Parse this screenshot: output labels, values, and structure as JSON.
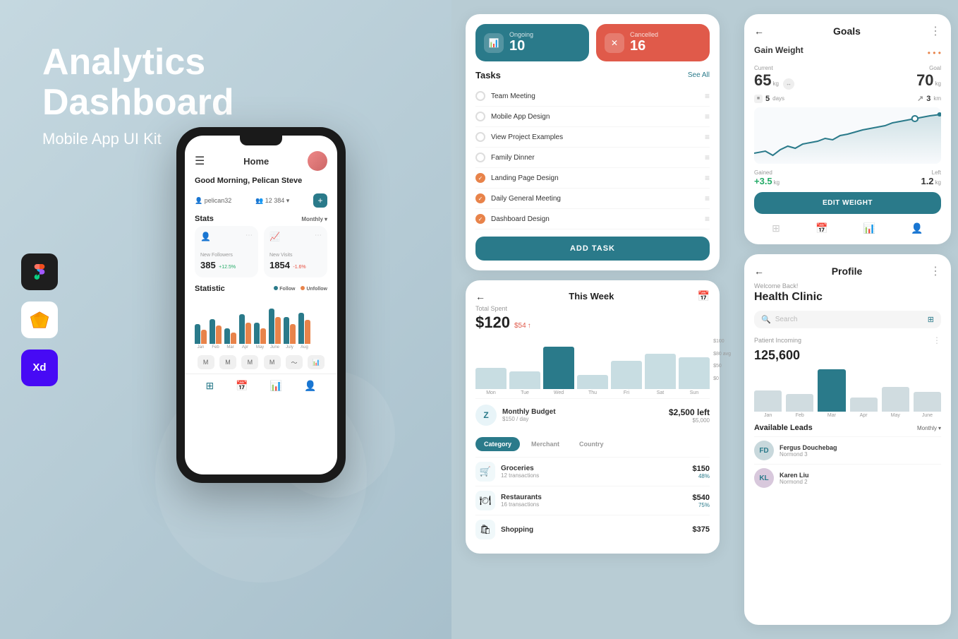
{
  "left": {
    "title_line1": "Analytics",
    "title_line2": "Dashboard",
    "subtitle": "Mobile App UI Kit",
    "phone": {
      "header_title": "Home",
      "greeting": "Good Morning, Pelican Steve",
      "username": "pelican32",
      "followers": "12 384",
      "stats_label": "Stats",
      "monthly_label": "Monthly",
      "new_followers_label": "New Followers",
      "new_followers_value": "385",
      "new_followers_change": "+12.5%",
      "new_visits_label": "New Visits",
      "new_visits_value": "1854",
      "new_visits_change": "-1.6%",
      "statistic_label": "Statistic",
      "legend_follow": "Follow",
      "legend_unfollow": "Unfollow",
      "months": [
        "Jan",
        "Feb",
        "Mar",
        "Apr",
        "May",
        "June",
        "July",
        "Aug"
      ]
    }
  },
  "tools": [
    {
      "name": "figma",
      "label": "Figma"
    },
    {
      "name": "sketch",
      "label": "Sketch"
    },
    {
      "name": "xd",
      "label": "XD"
    }
  ],
  "tasks": {
    "ongoing_label": "Ongoing",
    "ongoing_count": "10",
    "cancelled_label": "Cancelled",
    "cancelled_count": "16",
    "title": "Tasks",
    "see_all": "See All",
    "items": [
      {
        "text": "Team Meeting",
        "done": false
      },
      {
        "text": "Mobile App Design",
        "done": false
      },
      {
        "text": "View Project Examples",
        "done": false
      },
      {
        "text": "Family Dinner",
        "done": false
      },
      {
        "text": "Landing Page Design",
        "done": true
      },
      {
        "text": "Daily General Meeting",
        "done": true
      },
      {
        "text": "Dashboard Design",
        "done": true
      }
    ],
    "add_task_label": "ADD TASK"
  },
  "spending": {
    "title": "This Week",
    "total_spent_label": "Total Spent",
    "total_amount": "$120",
    "prev_amount": "$54",
    "y_labels": [
      "$100",
      "$80 avg",
      "$50",
      "$0"
    ],
    "days": [
      "Mon",
      "Tue",
      "Wed",
      "Thu",
      "Fri",
      "Sat",
      "Sun"
    ],
    "budget_label": "Monthly Budget",
    "budget_daily": "$150 / day",
    "budget_left": "$2,500 left",
    "budget_total": "$5,000",
    "budget_icon": "Z",
    "category_tabs": [
      "Category",
      "Merchant",
      "Country"
    ],
    "expenses": [
      {
        "name": "Groceries",
        "count": "12 transactions",
        "amount": "$150",
        "pct": "48%",
        "icon": "🛒"
      },
      {
        "name": "Restaurants",
        "count": "16 transactions",
        "amount": "$540",
        "pct": "75%",
        "icon": "🍽"
      },
      {
        "name": "Shopping",
        "count": "",
        "amount": "$375",
        "pct": "",
        "icon": "🛍"
      }
    ]
  },
  "goals": {
    "title": "Goals",
    "gain_weight_label": "Gain Weight",
    "current_label": "Current",
    "current_value": "65",
    "current_unit": "kg",
    "goal_label": "Goal",
    "goal_value": "70",
    "goal_unit": "kg",
    "rate_label1": "5",
    "rate_unit1": "days",
    "rate_label2": "3",
    "rate_unit2": "km",
    "gained_label": "Gained",
    "gained_value": "+3.5",
    "gained_unit": "kg",
    "left_label": "Left",
    "left_value": "1.2",
    "left_unit": "kg",
    "edit_btn": "EDIT WEIGHT"
  },
  "profile": {
    "title": "Profile",
    "welcome_label": "Welcome Back!",
    "clinic_name": "Health Clinic",
    "search_placeholder": "Search",
    "patient_incoming_label": "Patient Incoming",
    "patient_count": "125,600",
    "months": [
      "Jan",
      "Feb",
      "Mar",
      "Apr",
      "May",
      "June"
    ],
    "available_leads_title": "Available Leads",
    "monthly_label": "Monthly",
    "leads": [
      {
        "name": "Fergus Douchebag",
        "role": "Normond 3",
        "initials": "FD"
      }
    ]
  }
}
